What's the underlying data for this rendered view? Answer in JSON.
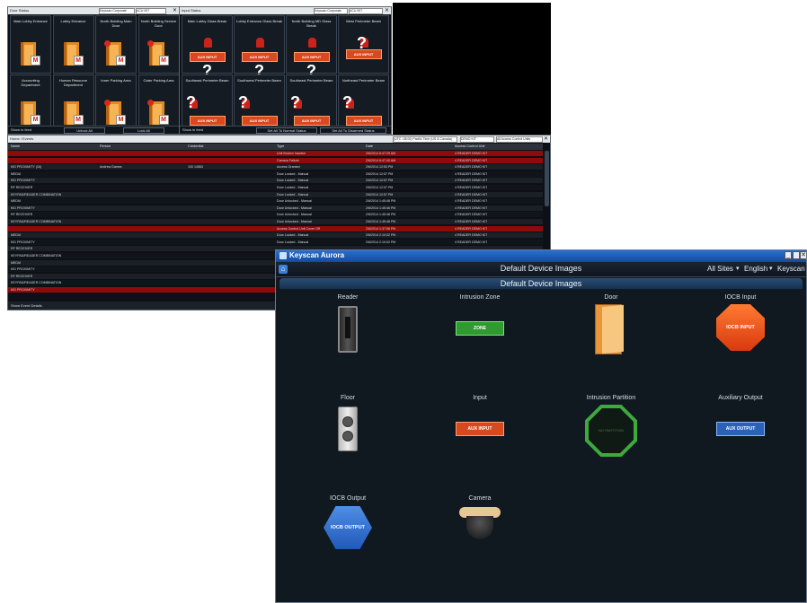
{
  "door_status": {
    "title": "Door Status",
    "combo1": "Keyscan Corporate",
    "combo2": "ACU 007",
    "tiles": [
      "Main Lobby Entrance",
      "Lobby Entrance",
      "North Building Main Door",
      "North Building Service Door",
      "Accounting Department",
      "Human Resource Department",
      "Inner Parking Area",
      "Outer Parking Area"
    ],
    "footer_left": "Show in feed",
    "btn_unlock": "Unlock All",
    "btn_lock": "Lock All"
  },
  "input_status": {
    "title": "Input Status",
    "combo1": "Keyscan Corporate",
    "combo2": "ACU 007",
    "tiles": [
      "Main Lobby Glass Break",
      "Lobby Entrance Glass Break",
      "North Building MD Glass Break",
      "West Perimeter Beam",
      "Southeast Perimeter Beam",
      "Southwest Perimeter Beam",
      "Southeast Perimeter Beam",
      "Northeast Perimeter Beam"
    ],
    "aux_label": "AUX INPUT",
    "footer_left": "Show in feed",
    "btn_normal": "Set All To Normal Status",
    "btn_disarm": "Set All To Disarmed Status"
  },
  "events": {
    "breadcrumb": "Home / Events",
    "top_combo": "(UTC -08:00) Pacific Time (US & Canada)",
    "top_combo2": "DEMO KIT",
    "top_combo3": "All Access Control Units",
    "columns": [
      "Name",
      "Person",
      "Credential",
      "Type",
      "Date",
      "Access Control Unit"
    ],
    "rows": [
      {
        "name": "",
        "person": "",
        "cred": "",
        "type": "Unit Broken Inactive",
        "date": "2/6/2014 6:47:29 AM",
        "acu": "4 READER DEMO KIT",
        "alarm": true
      },
      {
        "name": "",
        "person": "",
        "cred": "",
        "type": "Camera Failure",
        "date": "2/6/2014 6:47:40 AM",
        "acu": "4 READER DEMO KIT",
        "alarm": true
      },
      {
        "name": "KID PROXIMITY (16)",
        "person": "Andrew Gaines",
        "cred": "100 14563",
        "type": "Access Granted",
        "date": "2/6/2014 12:53 PM",
        "acu": "4 READER DEMO KIT",
        "alarm": false
      },
      {
        "name": "MEDIA",
        "person": "",
        "cred": "",
        "type": "Door Locked - Manual",
        "date": "2/6/2014 12:57 PM",
        "acu": "4 READER DEMO KIT",
        "alarm": false
      },
      {
        "name": "KID PROXIMITY",
        "person": "",
        "cred": "",
        "type": "Door Locked - Manual",
        "date": "2/6/2014 12:57 PM",
        "acu": "4 READER DEMO KIT",
        "alarm": false
      },
      {
        "name": "RF RECEIVER",
        "person": "",
        "cred": "",
        "type": "Door Locked - Manual",
        "date": "2/6/2014 12:57 PM",
        "acu": "4 READER DEMO KIT",
        "alarm": false
      },
      {
        "name": "KEYPAD/READER COMBINATION",
        "person": "",
        "cred": "",
        "type": "Door Locked - Manual",
        "date": "2/6/2014 12:57 PM",
        "acu": "4 READER DEMO KIT",
        "alarm": false
      },
      {
        "name": "MEDIA",
        "person": "",
        "cred": "",
        "type": "Door Unlocked - Manual",
        "date": "2/6/2014 1:45:46 PM",
        "acu": "4 READER DEMO KIT",
        "alarm": false
      },
      {
        "name": "KID PROXIMITY",
        "person": "",
        "cred": "",
        "type": "Door Unlocked - Manual",
        "date": "2/6/2014 1:45:46 PM",
        "acu": "4 READER DEMO KIT",
        "alarm": false
      },
      {
        "name": "RF RECEIVER",
        "person": "",
        "cred": "",
        "type": "Door Unlocked - Manual",
        "date": "2/6/2014 1:45:46 PM",
        "acu": "4 READER DEMO KIT",
        "alarm": false
      },
      {
        "name": "KEYPAD/READER COMBINATION",
        "person": "",
        "cred": "",
        "type": "Door Unlocked - Manual",
        "date": "2/6/2014 1:45:46 PM",
        "acu": "4 READER DEMO KIT",
        "alarm": false
      },
      {
        "name": "",
        "person": "",
        "cred": "",
        "type": "Access Control Unit Cover Off",
        "date": "2/6/2014 1:37:56 PM",
        "acu": "4 READER DEMO KIT",
        "alarm": true
      },
      {
        "name": "MEDIA",
        "person": "",
        "cred": "",
        "type": "Door Locked - Manual",
        "date": "2/6/2014 2:10:02 PM",
        "acu": "4 READER DEMO KIT",
        "alarm": false
      },
      {
        "name": "KID PROXIMITY",
        "person": "",
        "cred": "",
        "type": "Door Locked - Manual",
        "date": "2/6/2014 2:10:02 PM",
        "acu": "4 READER DEMO KIT",
        "alarm": false
      },
      {
        "name": "RF RECEIVER",
        "person": "",
        "cred": "",
        "type": "",
        "date": "",
        "acu": "",
        "alarm": false
      },
      {
        "name": "KEYPAD/READER COMBINATION",
        "person": "",
        "cred": "",
        "type": "",
        "date": "",
        "acu": "",
        "alarm": false
      },
      {
        "name": "MEDIA",
        "person": "",
        "cred": "",
        "type": "",
        "date": "",
        "acu": "",
        "alarm": false
      },
      {
        "name": "KID PROXIMITY",
        "person": "",
        "cred": "",
        "type": "",
        "date": "",
        "acu": "",
        "alarm": false
      },
      {
        "name": "RF RECEIVER",
        "person": "",
        "cred": "",
        "type": "",
        "date": "",
        "acu": "",
        "alarm": false
      },
      {
        "name": "KEYPAD/READER COMBINATION",
        "person": "",
        "cred": "",
        "type": "",
        "date": "",
        "acu": "",
        "alarm": false
      },
      {
        "name": "KID PROXIMITY",
        "person": "",
        "cred": "",
        "type": "",
        "date": "",
        "acu": "",
        "alarm": true
      }
    ],
    "footer": "Show Event Details"
  },
  "aurora": {
    "app_title": "Keyscan Aurora",
    "window_title": "Default Device Images",
    "sites": "All Sites",
    "language": "English",
    "user": "Keyscan",
    "panel_title": "Default Device Images",
    "devices": [
      {
        "name": "Reader"
      },
      {
        "name": "Intrusion Zone",
        "btn": "ZONE"
      },
      {
        "name": "Door"
      },
      {
        "name": "IOCB Input",
        "btn": "IOCB INPUT"
      },
      {
        "name": "Floor"
      },
      {
        "name": "Input",
        "btn": "AUX INPUT"
      },
      {
        "name": "Intrusion Partition",
        "btn": "NO PARTITION"
      },
      {
        "name": "Auxiliary Output",
        "btn": "AUX OUTPUT"
      },
      {
        "name": "IOCB Output",
        "btn": "IOCB OUTPUT"
      },
      {
        "name": "Camera"
      }
    ]
  },
  "colors": {
    "accent": "#2a6fd1",
    "alarm_row": "#8f0a0a",
    "aux_orange": "#d9491f",
    "zone_green": "#2f9a2f"
  }
}
